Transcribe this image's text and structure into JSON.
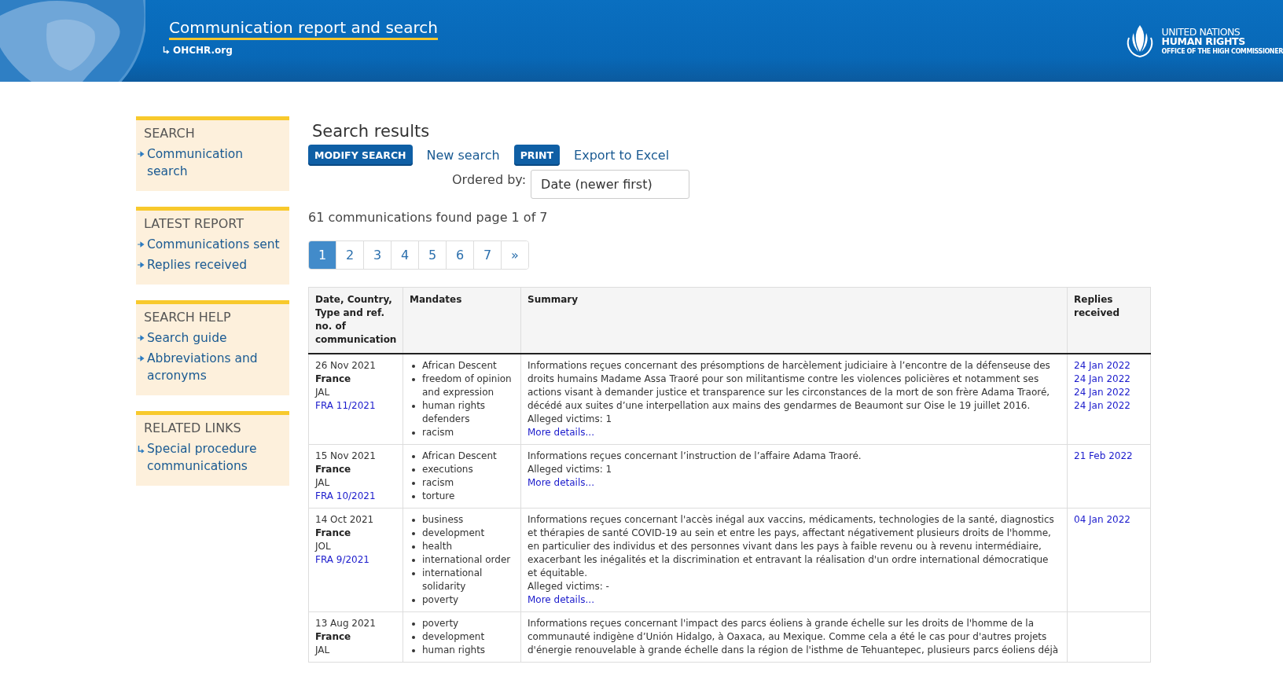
{
  "header": {
    "title": "Communication report and search",
    "link": "OHCHR.org",
    "logo_lines": [
      "UNITED NATIONS",
      "HUMAN RIGHTS",
      "OFFICE OF THE HIGH COMMISSIONER"
    ]
  },
  "sidebar": [
    {
      "heading": "SEARCH",
      "links": [
        {
          "label": "Communication search",
          "kind": "arrow"
        }
      ]
    },
    {
      "heading": "LATEST REPORT",
      "links": [
        {
          "label": "Communications sent",
          "kind": "arrow"
        },
        {
          "label": "Replies received",
          "kind": "arrow"
        }
      ]
    },
    {
      "heading": "SEARCH HELP",
      "links": [
        {
          "label": "Search guide",
          "kind": "arrow"
        },
        {
          "label": "Abbreviations and acronyms",
          "kind": "arrow"
        }
      ]
    },
    {
      "heading": "RELATED LINKS",
      "links": [
        {
          "label": "Special procedure communications",
          "kind": "return"
        }
      ]
    }
  ],
  "results": {
    "title": "Search results",
    "actions": [
      {
        "label": "MODIFY SEARCH",
        "kind": "button"
      },
      {
        "label": "New search",
        "kind": "link"
      },
      {
        "label": "PRINT",
        "kind": "button"
      },
      {
        "label": "Export to Excel",
        "kind": "link"
      }
    ],
    "order": {
      "label": "Ordered by:",
      "value": "Date (newer first)"
    },
    "count": "61 communications found page 1 of 7",
    "pages": [
      {
        "label": "1",
        "selected": true
      },
      {
        "label": "2",
        "selected": false
      },
      {
        "label": "3",
        "selected": false
      },
      {
        "label": "4",
        "selected": false
      },
      {
        "label": "5",
        "selected": false
      },
      {
        "label": "6",
        "selected": false
      },
      {
        "label": "7",
        "selected": false
      },
      {
        "label": "»",
        "selected": false
      }
    ]
  },
  "table": {
    "columns": [
      "Date, Country, Type and ref. no. of communication",
      "Mandates",
      "Summary",
      "Replies received"
    ],
    "rows": [
      {
        "date": "26 Nov 2021",
        "country": "France",
        "type": "JAL",
        "ref": "FRA 11/2021",
        "mandates": [
          "African Descent",
          "freedom of opinion and expression",
          "human rights defenders",
          "racism"
        ],
        "summary": "Informations reçues concernant des présomptions de harcèlement judiciaire à l’encontre de la défenseuse des droits humains Madame Assa Traoré pour son militantisme contre les violences policières et notamment ses actions visant à demander justice et transparence sur les circonstances de la mort de son frère Adama Traoré, décédé aux suites d’une interpellation aux mains des gendarmes de Beaumont sur Oise le 19 juillet 2016.",
        "victims": "Alleged victims: 1",
        "more": "More details...",
        "replies": [
          "24 Jan 2022",
          "24 Jan 2022",
          "24 Jan 2022",
          "24 Jan 2022"
        ]
      },
      {
        "date": "15 Nov 2021",
        "country": "France",
        "type": "JAL",
        "ref": "FRA 10/2021",
        "mandates": [
          "African Descent",
          "executions",
          "racism",
          "torture"
        ],
        "summary": "Informations reçues concernant l’instruction de l’affaire Adama Traoré.",
        "victims": "Alleged victims: 1",
        "more": "More details...",
        "replies": [
          "21 Feb 2022"
        ]
      },
      {
        "date": "14 Oct 2021",
        "country": "France",
        "type": "JOL",
        "ref": "FRA 9/2021",
        "mandates": [
          "business",
          "development",
          "health",
          "international order",
          "international solidarity",
          "poverty"
        ],
        "summary": "Informations reçues concernant l'accès inégal aux vaccins, médicaments, technologies de la santé, diagnostics et thérapies de santé COVID-19 au sein et entre les pays, affectant négativement plusieurs droits de l'homme, en particulier des individus et des personnes vivant dans les pays à faible revenu ou à revenu intermédiaire, exacerbant les inégalités et la discrimination et entravant la réalisation d'un ordre international démocratique et équitable.",
        "victims": "Alleged victims: -",
        "more": "More details...",
        "replies": [
          "04 Jan 2022"
        ]
      },
      {
        "date": "13 Aug 2021",
        "country": "France",
        "type": "JAL",
        "mandates": [
          "poverty",
          "development",
          "human rights"
        ],
        "summary": "Informations reçues concernant l'impact des parcs éoliens à grande échelle sur les droits de l'homme de la communauté indigène d’Unión Hidalgo, à Oaxaca, au Mexique. Comme cela a été le cas pour d'autres projets d'énergie renouvelable à grande échelle dans la région de l'isthme de Tehuantepec, plusieurs parcs éoliens déjà",
        "replies": []
      }
    ]
  }
}
